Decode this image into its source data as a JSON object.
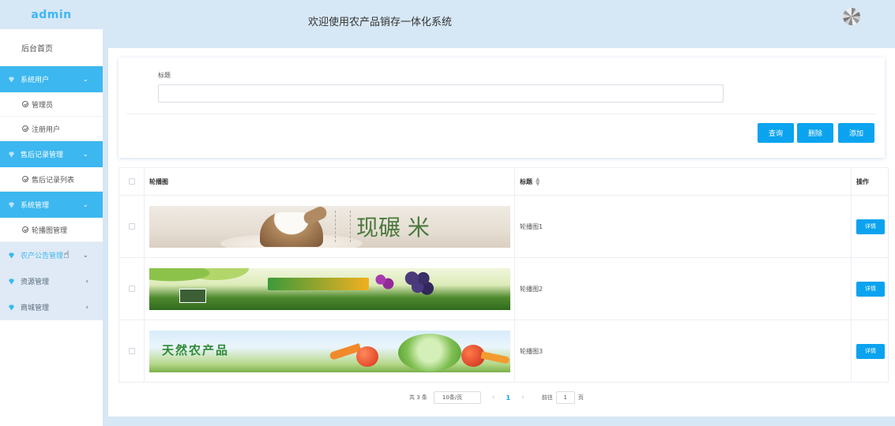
{
  "sidebar": {
    "brand": "admin",
    "home": "后台首页",
    "groups": [
      {
        "label": "系统用户",
        "arrow": "⌄",
        "subs": [
          "管理员",
          "注册用户"
        ]
      },
      {
        "label": "售后记录管理",
        "arrow": "⌄",
        "subs": [
          "售后记录列表"
        ]
      },
      {
        "label": "系统管理",
        "arrow": "⌄",
        "subs": [
          "轮播图管理"
        ]
      },
      {
        "label": "农产公告管理",
        "arrow": "⌄"
      },
      {
        "label": "资源管理",
        "arrow": "‹"
      },
      {
        "label": "商城管理",
        "arrow": "‹"
      }
    ]
  },
  "header": {
    "title": "欢迎使用农产品销存一体化系统"
  },
  "search": {
    "field_label": "标题",
    "value": "",
    "buttons": {
      "query": "查询",
      "delete": "删除",
      "add": "添加"
    }
  },
  "table": {
    "headers": {
      "image": "轮播图",
      "title": "标题",
      "action": "操作"
    },
    "rows": [
      {
        "title": "轮播图1",
        "action": "详情",
        "banner_text": "现碾 米"
      },
      {
        "title": "轮播图2",
        "action": "详情",
        "banner_text": ""
      },
      {
        "title": "轮播图3",
        "action": "详情",
        "banner_text": "天然农产品"
      }
    ]
  },
  "pager": {
    "total": "共 3 条",
    "page_size": "10条/页",
    "current": "1",
    "goto_label": "前往",
    "goto_value": "1",
    "page_suffix": "页"
  },
  "colors": {
    "accent": "#0ba3ef",
    "sidebar_active": "#3cb7ef",
    "background": "#d6e7f5"
  }
}
